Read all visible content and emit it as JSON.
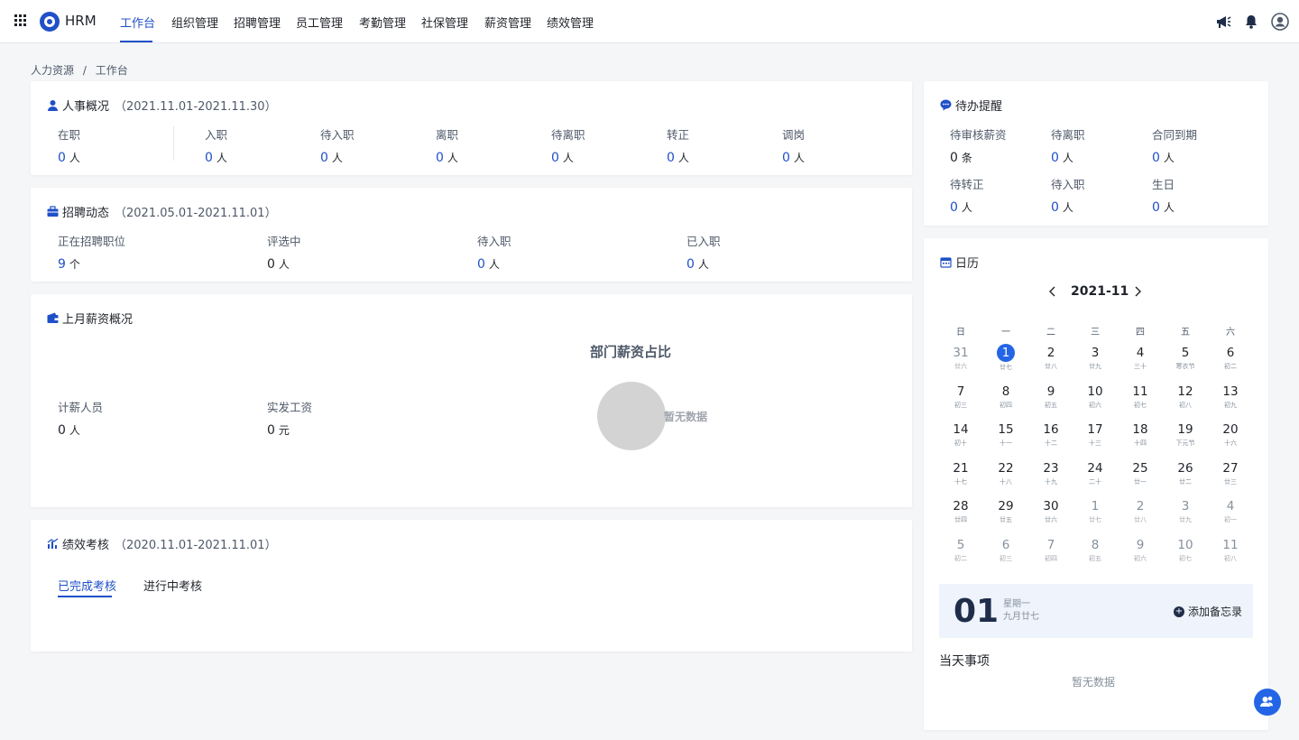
{
  "app": {
    "name": "HRM"
  },
  "nav": {
    "items": [
      {
        "label": "工作台",
        "active": true
      },
      {
        "label": "组织管理"
      },
      {
        "label": "招聘管理"
      },
      {
        "label": "员工管理"
      },
      {
        "label": "考勤管理"
      },
      {
        "label": "社保管理"
      },
      {
        "label": "薪资管理"
      },
      {
        "label": "绩效管理"
      }
    ]
  },
  "header_icons": [
    "megaphone-icon",
    "bell-icon",
    "user-avatar-icon"
  ],
  "colors": {
    "accent": "#2050c8",
    "selected_day": "#2465e6",
    "memo_bg": "#eef3fc"
  },
  "breadcrumb": {
    "root": "人力资源",
    "separator": "/",
    "current": "工作台"
  },
  "personnel": {
    "title": "人事概况",
    "range": "（2021.11.01-2021.11.30）",
    "stats": [
      {
        "label": "在职",
        "value": "0",
        "unit": "人"
      },
      {
        "label": "入职",
        "value": "0",
        "unit": "人"
      },
      {
        "label": "待入职",
        "value": "0",
        "unit": "人"
      },
      {
        "label": "离职",
        "value": "0",
        "unit": "人"
      },
      {
        "label": "待离职",
        "value": "0",
        "unit": "人"
      },
      {
        "label": "转正",
        "value": "0",
        "unit": "人"
      },
      {
        "label": "调岗",
        "value": "0",
        "unit": "人"
      }
    ]
  },
  "recruit": {
    "title": "招聘动态",
    "range": "（2021.05.01-2021.11.01）",
    "stats": [
      {
        "label": "正在招聘职位",
        "value": "9",
        "unit": "个"
      },
      {
        "label": "评选中",
        "value": "0",
        "unit": "人"
      },
      {
        "label": "待入职",
        "value": "0",
        "unit": "人"
      },
      {
        "label": "已入职",
        "value": "0",
        "unit": "人"
      }
    ]
  },
  "salary": {
    "title": "上月薪资概况",
    "stats": [
      {
        "label": "计薪人员",
        "value": "0",
        "unit": "人"
      },
      {
        "label": "实发工资",
        "value": "0",
        "unit": "元"
      }
    ],
    "chart_title": "部门薪资占比",
    "chart_empty": "暂无数据"
  },
  "performance": {
    "title": "绩效考核",
    "range": "（2020.11.01-2021.11.01）",
    "tabs": [
      {
        "label": "已完成考核",
        "active": true
      },
      {
        "label": "进行中考核"
      }
    ]
  },
  "todo": {
    "title": "待办提醒",
    "items": [
      {
        "label": "待审核薪资",
        "value": "0",
        "unit": "条"
      },
      {
        "label": "待离职",
        "value": "0",
        "unit": "人"
      },
      {
        "label": "合同到期",
        "value": "0",
        "unit": "人"
      },
      {
        "label": "待转正",
        "value": "0",
        "unit": "人"
      },
      {
        "label": "待入职",
        "value": "0",
        "unit": "人"
      },
      {
        "label": "生日",
        "value": "0",
        "unit": "人"
      }
    ]
  },
  "calendar": {
    "title": "日历",
    "month": "2021-11",
    "weekdays": [
      "日",
      "一",
      "二",
      "三",
      "四",
      "五",
      "六"
    ],
    "days": [
      {
        "d": "31",
        "l": "廿六",
        "other": true
      },
      {
        "d": "1",
        "l": "廿七",
        "sel": true
      },
      {
        "d": "2",
        "l": "廿八"
      },
      {
        "d": "3",
        "l": "廿九"
      },
      {
        "d": "4",
        "l": "三十"
      },
      {
        "d": "5",
        "l": "寒衣节"
      },
      {
        "d": "6",
        "l": "初二"
      },
      {
        "d": "7",
        "l": "初三"
      },
      {
        "d": "8",
        "l": "初四"
      },
      {
        "d": "9",
        "l": "初五"
      },
      {
        "d": "10",
        "l": "初六"
      },
      {
        "d": "11",
        "l": "初七"
      },
      {
        "d": "12",
        "l": "初八"
      },
      {
        "d": "13",
        "l": "初九"
      },
      {
        "d": "14",
        "l": "初十"
      },
      {
        "d": "15",
        "l": "十一"
      },
      {
        "d": "16",
        "l": "十二"
      },
      {
        "d": "17",
        "l": "十三"
      },
      {
        "d": "18",
        "l": "十四"
      },
      {
        "d": "19",
        "l": "下元节"
      },
      {
        "d": "20",
        "l": "十六"
      },
      {
        "d": "21",
        "l": "十七"
      },
      {
        "d": "22",
        "l": "十八"
      },
      {
        "d": "23",
        "l": "十九"
      },
      {
        "d": "24",
        "l": "二十"
      },
      {
        "d": "25",
        "l": "廿一"
      },
      {
        "d": "26",
        "l": "廿二"
      },
      {
        "d": "27",
        "l": "廿三"
      },
      {
        "d": "28",
        "l": "廿四"
      },
      {
        "d": "29",
        "l": "廿五"
      },
      {
        "d": "30",
        "l": "廿六"
      },
      {
        "d": "1",
        "l": "廿七",
        "other": true
      },
      {
        "d": "2",
        "l": "廿八",
        "other": true
      },
      {
        "d": "3",
        "l": "廿九",
        "other": true
      },
      {
        "d": "4",
        "l": "初一",
        "other": true
      },
      {
        "d": "5",
        "l": "初二",
        "other": true
      },
      {
        "d": "6",
        "l": "初三",
        "other": true
      },
      {
        "d": "7",
        "l": "初四",
        "other": true
      },
      {
        "d": "8",
        "l": "初五",
        "other": true
      },
      {
        "d": "9",
        "l": "初六",
        "other": true
      },
      {
        "d": "10",
        "l": "初七",
        "other": true
      },
      {
        "d": "11",
        "l": "初八",
        "other": true
      }
    ],
    "memo": {
      "day": "01",
      "weekday": "星期一",
      "lunar": "九月廿七",
      "add_label": "添加备忘录"
    },
    "today_title": "当天事项",
    "today_empty": "暂无数据"
  }
}
